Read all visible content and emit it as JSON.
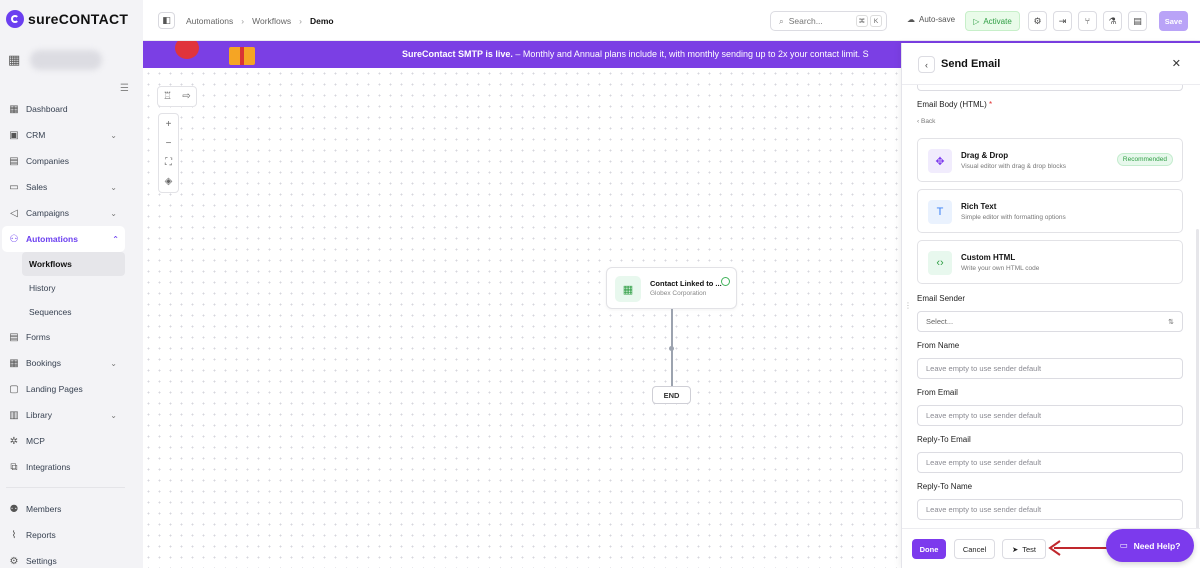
{
  "brand": {
    "name": "sureCONTACT",
    "accent": "#7c3aed"
  },
  "sidebar": {
    "items": [
      {
        "label": "Dashboard",
        "icon": "grid-icon"
      },
      {
        "label": "CRM",
        "icon": "contact-card-icon",
        "chevron": true
      },
      {
        "label": "Companies",
        "icon": "building-icon"
      },
      {
        "label": "Sales",
        "icon": "briefcase-icon",
        "chevron": true
      },
      {
        "label": "Campaigns",
        "icon": "megaphone-icon",
        "chevron": true
      },
      {
        "label": "Automations",
        "icon": "flow-icon",
        "chevron": true,
        "active": true
      }
    ],
    "sub_items": [
      {
        "label": "Workflows",
        "active": true
      },
      {
        "label": "History"
      },
      {
        "label": "Sequences"
      }
    ],
    "items_after": [
      {
        "label": "Forms",
        "icon": "form-icon"
      },
      {
        "label": "Bookings",
        "icon": "calendar-icon",
        "chevron": true
      },
      {
        "label": "Landing Pages",
        "icon": "page-icon"
      },
      {
        "label": "Library",
        "icon": "library-icon",
        "chevron": true
      },
      {
        "label": "MCP",
        "icon": "mcp-icon"
      },
      {
        "label": "Integrations",
        "icon": "puzzle-icon"
      }
    ],
    "items_bottom": [
      {
        "label": "Members",
        "icon": "users-icon"
      },
      {
        "label": "Reports",
        "icon": "chart-icon"
      },
      {
        "label": "Settings",
        "icon": "gear-icon"
      }
    ]
  },
  "topbar": {
    "breadcrumbs": [
      "Automations",
      "Workflows",
      "Demo"
    ],
    "search_placeholder": "Search...",
    "search_kbd": [
      "⌘",
      "K"
    ],
    "autosave_label": "Auto-save",
    "activate_label": "Activate",
    "save_label": "Save"
  },
  "banner": {
    "bold": "SureContact SMTP is live.",
    "text": " – Monthly and Annual plans include it, with monthly sending up to 2x your contact limit. S"
  },
  "canvas": {
    "node": {
      "title": "Contact Linked to ...",
      "subtitle": "Globex Corporation"
    },
    "end_label": "END"
  },
  "panel": {
    "title": "Send Email",
    "email_body_label": "Email Body (HTML)",
    "required_mark": "*",
    "back_label": "Back",
    "options": [
      {
        "title": "Drag & Drop",
        "desc": "Visual editor with drag & drop blocks",
        "badge": "Recommended",
        "icon": "drag-drop-icon",
        "color": "#7c3aed",
        "bg": "#f1ecfd"
      },
      {
        "title": "Rich Text",
        "desc": "Simple editor with formatting options",
        "icon": "text-icon",
        "color": "#3b82f6",
        "bg": "#eaf2fe"
      },
      {
        "title": "Custom HTML",
        "desc": "Write your own HTML code",
        "icon": "code-icon",
        "color": "#2f9e44",
        "bg": "#e8f8ee"
      }
    ],
    "sender_label": "Email Sender",
    "sender_value": "Select...",
    "from_name_label": "From Name",
    "from_email_label": "From Email",
    "reply_email_label": "Reply-To Email",
    "reply_name_label": "Reply-To Name",
    "placeholder": "Leave empty to use sender default",
    "done_label": "Done",
    "cancel_label": "Cancel",
    "test_label": "Test"
  },
  "help_label": "Need Help?"
}
